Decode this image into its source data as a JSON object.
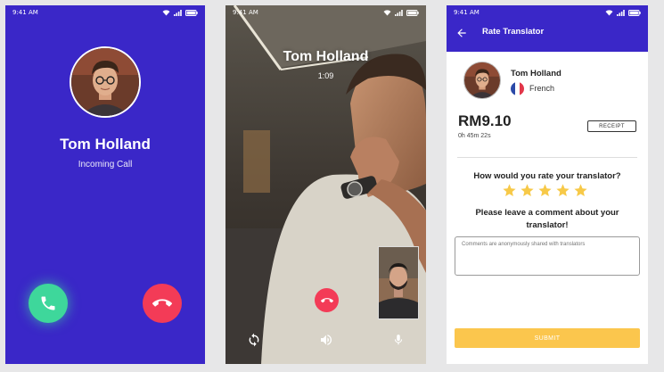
{
  "status": {
    "time": "9:41 AM"
  },
  "incoming": {
    "name": "Tom Holland",
    "subtitle": "Incoming Call",
    "colors": {
      "background": "#3a27c8",
      "accept": "#3ed79b",
      "decline": "#f33b57"
    }
  },
  "video_call": {
    "name": "Tom Holland",
    "timer": "1:09"
  },
  "rate": {
    "title": "Rate Translator",
    "translator_name": "Tom Holland",
    "language": "French",
    "price": "RM9.10",
    "duration": "0h 45m 22s",
    "receipt_label": "RECEIPT",
    "question": "How would you rate your translator?",
    "stars": 5,
    "comment_prompt": "Please leave a comment about your translator!",
    "comment_placeholder": "Comments are anonymously shared with translators",
    "submit_label": "SUBMIT",
    "colors": {
      "header": "#3a27c8",
      "star": "#f7c948",
      "submit": "#fbc64d"
    }
  }
}
